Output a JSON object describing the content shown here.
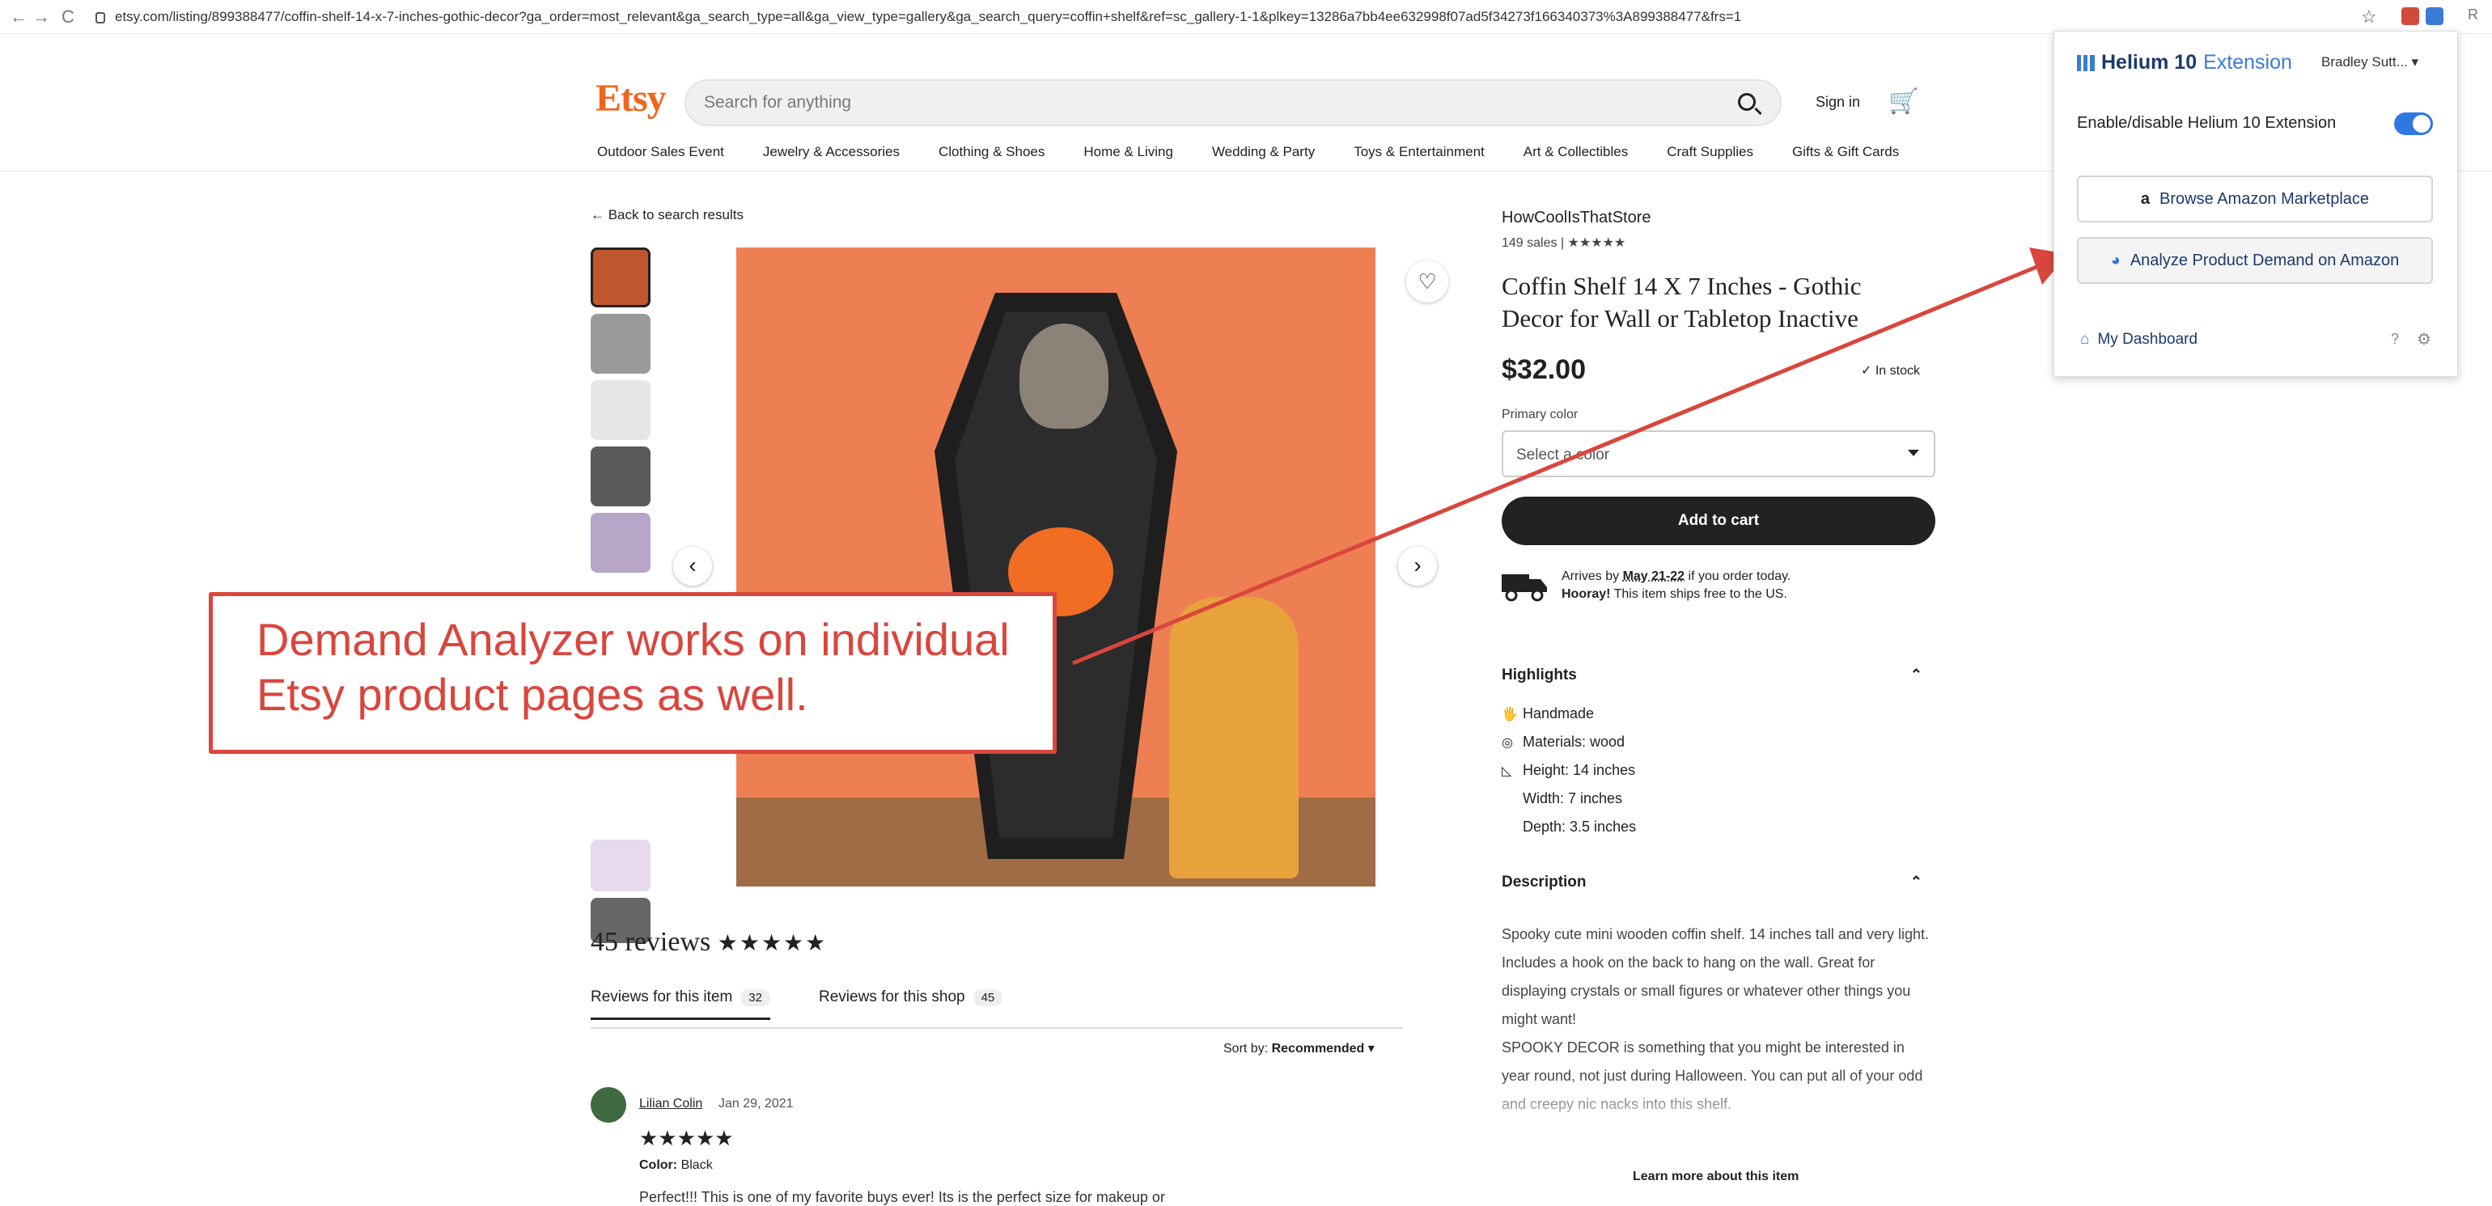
{
  "browser": {
    "url": "etsy.com/listing/899388477/coffin-shelf-14-x-7-inches-gothic-decor?ga_order=most_relevant&ga_search_type=all&ga_view_type=gallery&ga_search_query=coffin+shelf&ref=sc_gallery-1-1&plkey=13286a7bb4ee632998f07ad5f34273f166340373%3A899388477&frs=1",
    "back": "←",
    "forward": "→",
    "reload": "C",
    "ext_letter": "R"
  },
  "header": {
    "logo": "Etsy",
    "search_placeholder": "Search for anything",
    "signin": "Sign in",
    "categories": [
      "Outdoor Sales Event",
      "Jewelry & Accessories",
      "Clothing & Shoes",
      "Home & Living",
      "Wedding & Party",
      "Toys & Entertainment",
      "Art & Collectibles",
      "Craft Supplies",
      "Gifts & Gift Cards"
    ]
  },
  "listing": {
    "back_link": "← Back to search results",
    "shop": "HowCoolIsThatStore",
    "sales": "149 sales",
    "sales_stars": "★★★★★",
    "title": "Coffin Shelf 14 X 7 Inches - Gothic Decor for Wall or Tabletop Inactive",
    "price": "$32.00",
    "stock": "✓ In stock",
    "primary_color_label": "Primary color",
    "select_placeholder": "Select a color",
    "add_to_cart": "Add to cart",
    "ship_line1_pre": "Arrives by ",
    "ship_dates": "May 21-22",
    "ship_line1_post": " if you order today.",
    "ship_line2_bold": "Hooray!",
    "ship_line2": " This item ships free to the US.",
    "highlights_title": "Highlights",
    "highlights": [
      {
        "icon": "🖐",
        "text": "Handmade"
      },
      {
        "icon": "◎",
        "text": "Materials: wood"
      },
      {
        "icon": "◺",
        "text": "Height: 14 inches"
      },
      {
        "icon": "",
        "text": "Width: 7 inches"
      },
      {
        "icon": "",
        "text": "Depth: 3.5 inches"
      }
    ],
    "description_title": "Description",
    "description": "Spooky cute mini wooden coffin shelf. 14 inches tall and very light. Includes a hook on the back to hang on the wall. Great for displaying crystals or small figures or whatever other things you might want!\nSPOOKY DECOR is something that you might be interested in year round, not just during Halloween. You can put all of your odd and creepy nic nacks into this shelf.",
    "learn_more": "Learn more about this item"
  },
  "reviews": {
    "title": "45 reviews",
    "stars": "★★★★★",
    "tab_item": "Reviews for this item",
    "tab_item_count": "32",
    "tab_shop": "Reviews for this shop",
    "tab_shop_count": "45",
    "sort_label": "Sort by:",
    "sort_value": "Recommended",
    "reviewer": "Lilian Colin",
    "date": "Jan 29, 2021",
    "review_stars": "★★★★★",
    "color_label": "Color:",
    "color_value": "Black",
    "text": "Perfect!!! This is one of my favorite buys ever! Its is the perfect size for makeup or"
  },
  "helium": {
    "brand": "Helium 10",
    "brand_suffix": "Extension",
    "user": "Bradley Sutt...",
    "toggle_label": "Enable/disable Helium 10 Extension",
    "toggle_on": true,
    "browse_icon": "a",
    "browse": "Browse Amazon Marketplace",
    "analyze": "Analyze Product Demand on Amazon",
    "dashboard": "My Dashboard",
    "accent": "#2f78e2"
  },
  "callout": {
    "line1": "Demand Analyzer works on individual",
    "line2": "Etsy product pages as well.",
    "color": "#d9463d"
  },
  "icons": {
    "heart": "♡",
    "prev": "‹",
    "next": "›",
    "chevron_up": "⌃",
    "cart": "🛒",
    "help": "?",
    "gear": "⚙",
    "home": "⌂",
    "pie": "◕",
    "caret": "▾",
    "star_outline": "☆"
  }
}
